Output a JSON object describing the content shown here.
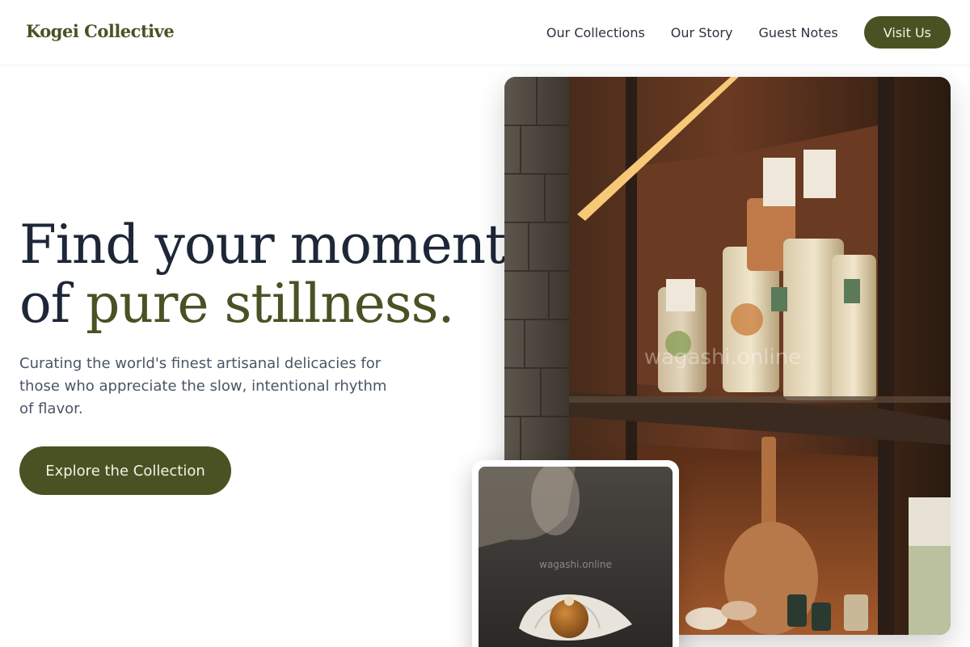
{
  "header": {
    "logo": "Kogei Collective",
    "nav": [
      {
        "label": "Our Collections"
      },
      {
        "label": "Our Story"
      },
      {
        "label": "Guest Notes"
      }
    ],
    "visit_label": "Visit Us"
  },
  "hero": {
    "headline_line1": "Find your moment",
    "headline_line2_plain": "of ",
    "headline_line2_accent": "pure stillness.",
    "subtitle": "Curating the world's finest artisanal delicacies for those who appreciate the slow, intentional rhythm of flavor.",
    "cta_label": "Explore the Collection"
  },
  "images": {
    "main_watermark": "wagashi.online",
    "small_watermark": "wagashi.online"
  },
  "colors": {
    "brand": "#4a5224",
    "headline": "#1d2738",
    "body_text": "#4a5565"
  }
}
